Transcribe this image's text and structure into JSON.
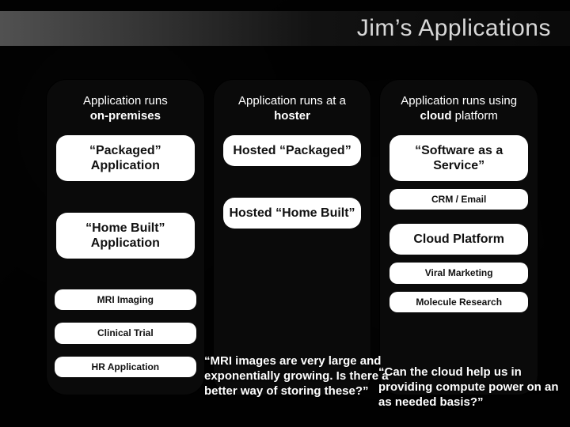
{
  "title": "Jim’s Applications",
  "columns": {
    "col1": {
      "head_l1": "Application runs",
      "head_l2": "on-premises",
      "cells": {
        "packaged": "“Packaged” Application",
        "homebuilt": "“Home Built” Application"
      },
      "pills": {
        "mri": "MRI Imaging",
        "clinical": "Clinical Trial",
        "hr": "HR Application"
      }
    },
    "col2": {
      "head_l1": "Application runs at a",
      "head_l2": "hoster",
      "cells": {
        "hosted_packaged": "Hosted “Packaged”",
        "hosted_homebuilt": "Hosted “Home Built”"
      }
    },
    "col3": {
      "head_l1": "Application runs using",
      "head_l2_strong": "cloud",
      "head_l2_light": " platform",
      "cells": {
        "saas": "“Software as a Service”",
        "cloud_platform": "Cloud Platform"
      },
      "pills": {
        "crm": "CRM / Email",
        "viral": "Viral Marketing",
        "molecule": "Molecule Research"
      }
    }
  },
  "quotes": {
    "q1": "“MRI images are very large and exponentially growing. Is there a better way of storing these?”",
    "q2": "“Can the cloud help us in providing compute power on an as needed basis?”"
  }
}
